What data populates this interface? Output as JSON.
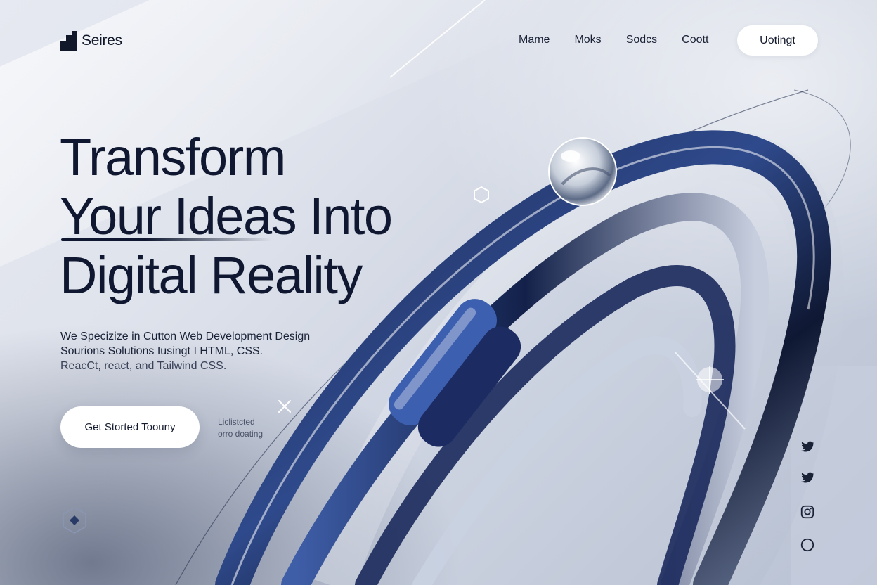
{
  "brand": {
    "name": "Seires"
  },
  "nav": {
    "items": [
      "Mame",
      "Moks",
      "Sodcs",
      "Coott"
    ]
  },
  "header_cta": {
    "label": "Uotingt"
  },
  "hero": {
    "headline": [
      "Transform",
      "Your Ideas Into",
      "Digital Reality"
    ],
    "description": [
      "We Specizize in Cutton Web Development Design",
      "Sourions Solutions Iusingt I HTML, CSS.",
      "ReacCt, react, and Tailwind CSS."
    ],
    "primary_button": "Get Storted Toouny",
    "side_note": [
      "Liclistcted",
      "orro doating"
    ]
  },
  "social": {
    "icons": [
      "twitter-icon",
      "twitter-icon",
      "instagram-icon",
      "circle-icon"
    ]
  },
  "colors": {
    "text_dark": "#0f1830",
    "accent_navy": "#1b2a5c",
    "accent_blue": "#3a5aa8",
    "button_bg": "#ffffff",
    "background": "#dfe3ec"
  }
}
